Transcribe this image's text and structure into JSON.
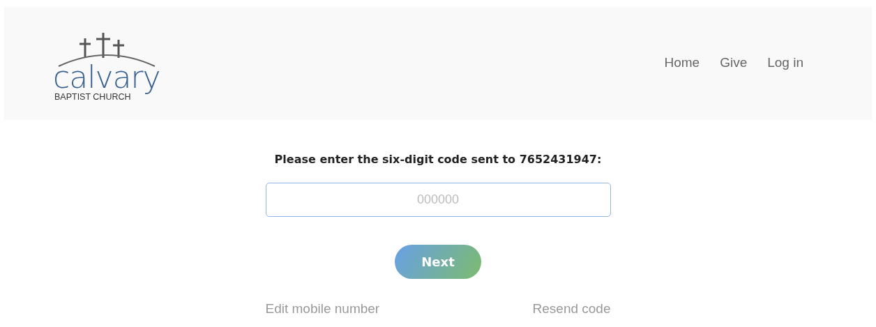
{
  "header": {
    "logo": {
      "name": "calvary",
      "subtitle": "BAPTIST CHURCH"
    },
    "nav": [
      {
        "label": "Home"
      },
      {
        "label": "Give"
      },
      {
        "label": "Log in"
      }
    ]
  },
  "form": {
    "prompt": "Please enter the six-digit code sent to 7652431947:",
    "code_field": {
      "placeholder": "000000"
    },
    "submit": "Next",
    "links": [
      {
        "label": "Edit mobile number"
      },
      {
        "label": "Resend code"
      }
    ]
  }
}
